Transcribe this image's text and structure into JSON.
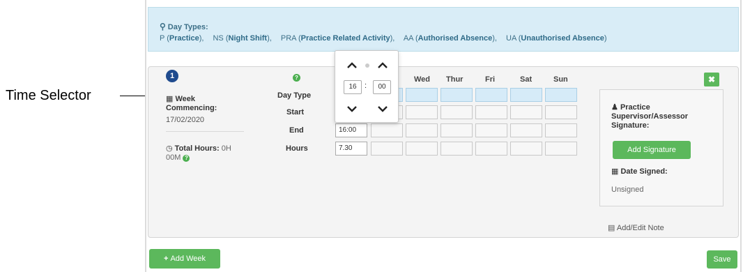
{
  "annotation": {
    "label": "Time Selector"
  },
  "info_box": {
    "title": "Day Types:",
    "types": [
      {
        "code": "P",
        "name": "Practice"
      },
      {
        "code": "NS",
        "name": "Night Shift"
      },
      {
        "code": "PRA",
        "name": "Practice Related Activity"
      },
      {
        "code": "AA",
        "name": "Authorised Absence"
      },
      {
        "code": "UA",
        "name": "Unauthorised Absence"
      }
    ]
  },
  "week": {
    "badge": "1",
    "commencing_label": "Week Commencing:",
    "commencing_date": "17/02/2020",
    "total_label": "Total Hours:",
    "total_value": "0H 00M"
  },
  "grid": {
    "row_labels": {
      "day_type": "Day Type",
      "start": "Start",
      "end": "End",
      "hours": "Hours"
    },
    "days": [
      "Wed",
      "Thur",
      "Fri",
      "Sat",
      "Sun"
    ],
    "first_day_values": {
      "end": "16:00",
      "hours": "7.30"
    }
  },
  "time_picker": {
    "hour": "16",
    "separator": ":",
    "minute": "00"
  },
  "signature": {
    "title": "Practice Supervisor/Assessor Signature:",
    "button": "Add Signature",
    "date_label": "Date Signed:",
    "status": "Unsigned"
  },
  "note_link": "Add/Edit Note",
  "footer": {
    "add_week": "Add Week",
    "save": "Save"
  },
  "colors": {
    "accent_green": "#5cb85c",
    "info_bg": "#d9edf7",
    "badge_blue": "#1f4b8e"
  }
}
